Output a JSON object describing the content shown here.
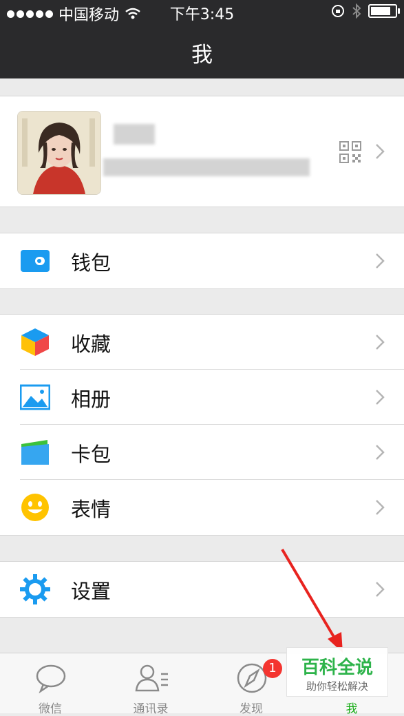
{
  "status_bar": {
    "carrier": "中国移动",
    "time": "下午3:45"
  },
  "nav": {
    "title": "我"
  },
  "profile": {
    "qr_icon": "qr-code-icon"
  },
  "menu": {
    "wallet": "钱包",
    "favorites": "收藏",
    "album": "相册",
    "cards": "卡包",
    "stickers": "表情",
    "settings": "设置"
  },
  "tabs": [
    {
      "label": "微信",
      "icon": "chat-icon"
    },
    {
      "label": "通讯录",
      "icon": "contacts-icon"
    },
    {
      "label": "发现",
      "icon": "compass-icon",
      "badge": "1"
    },
    {
      "label": "我",
      "icon": "me-icon",
      "active": true
    }
  ],
  "watermark": {
    "title": "百科全说",
    "subtitle": "助你轻松解决"
  },
  "colors": {
    "accent": "#1aad19",
    "nav_bg": "#2a2a2c",
    "badge": "#f43530",
    "icon_blue": "#1a9bf0"
  }
}
